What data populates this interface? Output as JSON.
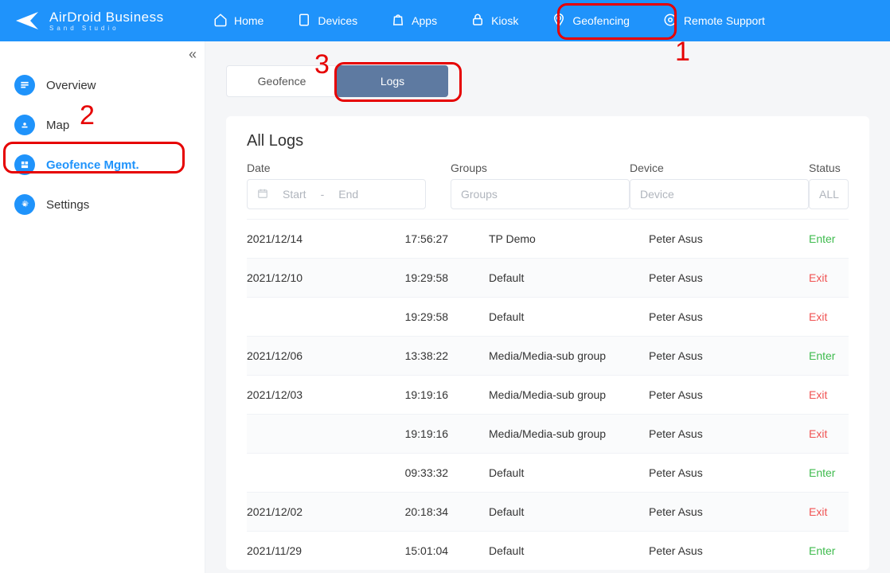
{
  "brand": {
    "name": "AirDroid Business",
    "sub": "Sand Studio"
  },
  "topnav": {
    "items": [
      {
        "label": "Home"
      },
      {
        "label": "Devices"
      },
      {
        "label": "Apps"
      },
      {
        "label": "Kiosk"
      },
      {
        "label": "Geofencing"
      },
      {
        "label": "Remote Support"
      }
    ]
  },
  "sidebar": {
    "items": [
      {
        "label": "Overview"
      },
      {
        "label": "Map"
      },
      {
        "label": "Geofence Mgmt."
      },
      {
        "label": "Settings"
      }
    ]
  },
  "tabs": {
    "geofence": "Geofence",
    "logs": "Logs"
  },
  "page": {
    "title": "All Logs",
    "headers": {
      "date": "Date",
      "groups": "Groups",
      "device": "Device",
      "status": "Status"
    },
    "filters": {
      "start": "Start",
      "sep": "-",
      "end": "End",
      "groups_ph": "Groups",
      "device_ph": "Device",
      "status_ph": "ALL"
    },
    "rows": [
      {
        "date": "2021/12/14",
        "time": "17:56:27",
        "group": "TP Demo",
        "device": "Peter Asus",
        "status": "Enter"
      },
      {
        "date": "2021/12/10",
        "time": "19:29:58",
        "group": "Default",
        "device": "Peter Asus",
        "status": "Exit"
      },
      {
        "date": "",
        "time": "19:29:58",
        "group": "Default",
        "device": "Peter Asus",
        "status": "Exit"
      },
      {
        "date": "2021/12/06",
        "time": "13:38:22",
        "group": "Media/Media-sub group",
        "device": "Peter Asus",
        "status": "Enter"
      },
      {
        "date": "2021/12/03",
        "time": "19:19:16",
        "group": "Media/Media-sub group",
        "device": "Peter Asus",
        "status": "Exit"
      },
      {
        "date": "",
        "time": "19:19:16",
        "group": "Media/Media-sub group",
        "device": "Peter Asus",
        "status": "Exit"
      },
      {
        "date": "",
        "time": "09:33:32",
        "group": "Default",
        "device": "Peter Asus",
        "status": "Enter"
      },
      {
        "date": "2021/12/02",
        "time": "20:18:34",
        "group": "Default",
        "device": "Peter Asus",
        "status": "Exit"
      },
      {
        "date": "2021/11/29",
        "time": "15:01:04",
        "group": "Default",
        "device": "Peter Asus",
        "status": "Enter"
      }
    ]
  },
  "annotations": {
    "n1": "1",
    "n2": "2",
    "n3": "3"
  }
}
